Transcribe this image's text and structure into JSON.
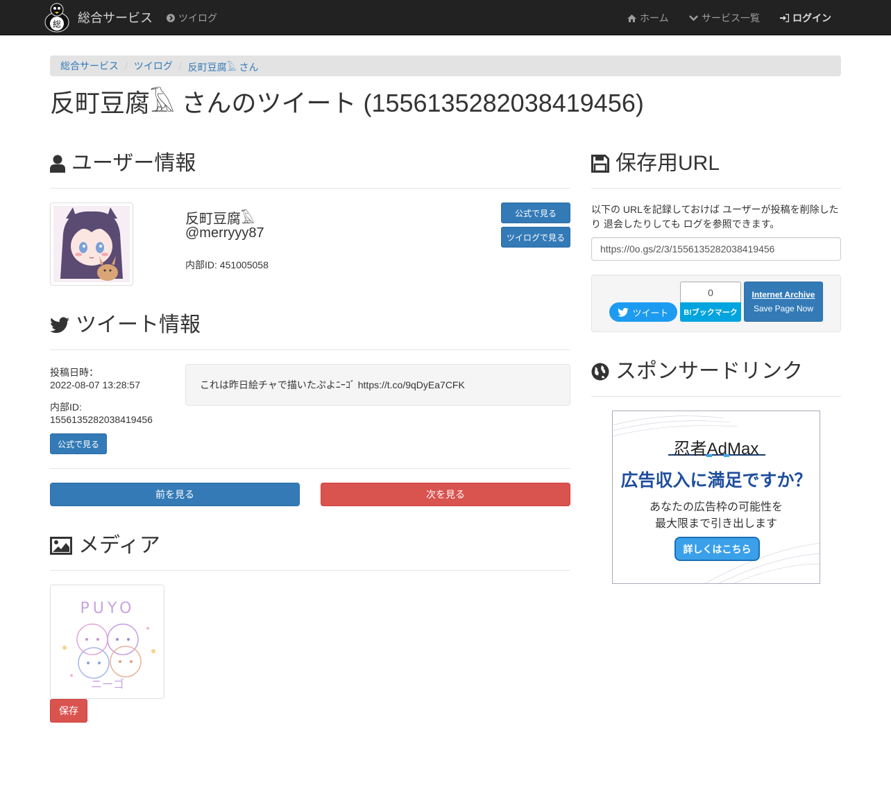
{
  "navbar": {
    "brand": "総合サービス",
    "logo_icon": "penguin-logo-icon",
    "twilog_link": "ツイログ",
    "home_link": "ホーム",
    "services_link": "サービス一覧",
    "login_link": "ログイン"
  },
  "breadcrumb": [
    "総合サービス",
    "ツイログ",
    "反町豆腐𓄿 さん"
  ],
  "page_title": "反町豆腐𓄿 さんのツイート (1556135282038419456)",
  "user_section": {
    "heading": "ユーザー情報",
    "display_name": "反町豆腐𓄿",
    "handle": "@merryyy87",
    "internal_id": "内部ID: 451005058",
    "btn_official": "公式で見る",
    "btn_twilog": "ツイログで見る"
  },
  "tweet_section": {
    "heading": "ツイート情報",
    "posted_label": "投稿日時：",
    "posted_value": "2022-08-07 13:28:57",
    "internal_id_label": "内部ID:",
    "internal_id_value": "1556135282038419456",
    "btn_official": "公式で見る",
    "text": "これは昨日絵チャで描いたぷよﾆｰｺﾞ https://t.co/9qDyEa7CFK",
    "btn_prev": "前を見る",
    "btn_next": "次を見る"
  },
  "media_section": {
    "heading": "メディア",
    "save_btn": "保存",
    "image_labels": [
      "PUYO",
      "ニーゴ"
    ]
  },
  "save_url_section": {
    "heading": "保存用URL",
    "description": "以下の URLを記録しておけば ユーザーが投稿を削除したり 退会したりしても ログを参照できます。",
    "url": "https://0o.gs/2/3/1556135282038419456",
    "tweet_btn": "ツイート",
    "hatena_count": "0",
    "hatena_btn": "B!ブックマーク",
    "ia_title": "Internet Archive",
    "ia_sub": "Save Page Now"
  },
  "sponsor_section": {
    "heading": "スポンサードリンク",
    "ad_brand": "忍者AdMax",
    "ad_headline": "広告収入に満足ですか？",
    "ad_sub1": "あなたの広告枠の可能性を",
    "ad_sub2": "最大限まで引き出します",
    "ad_button": "詳しくはこちら"
  },
  "colors": {
    "navbar_bg": "#222222",
    "primary": "#337ab7",
    "danger": "#d9534f",
    "twitter": "#1d9bf0",
    "hatena": "#00a4de"
  }
}
